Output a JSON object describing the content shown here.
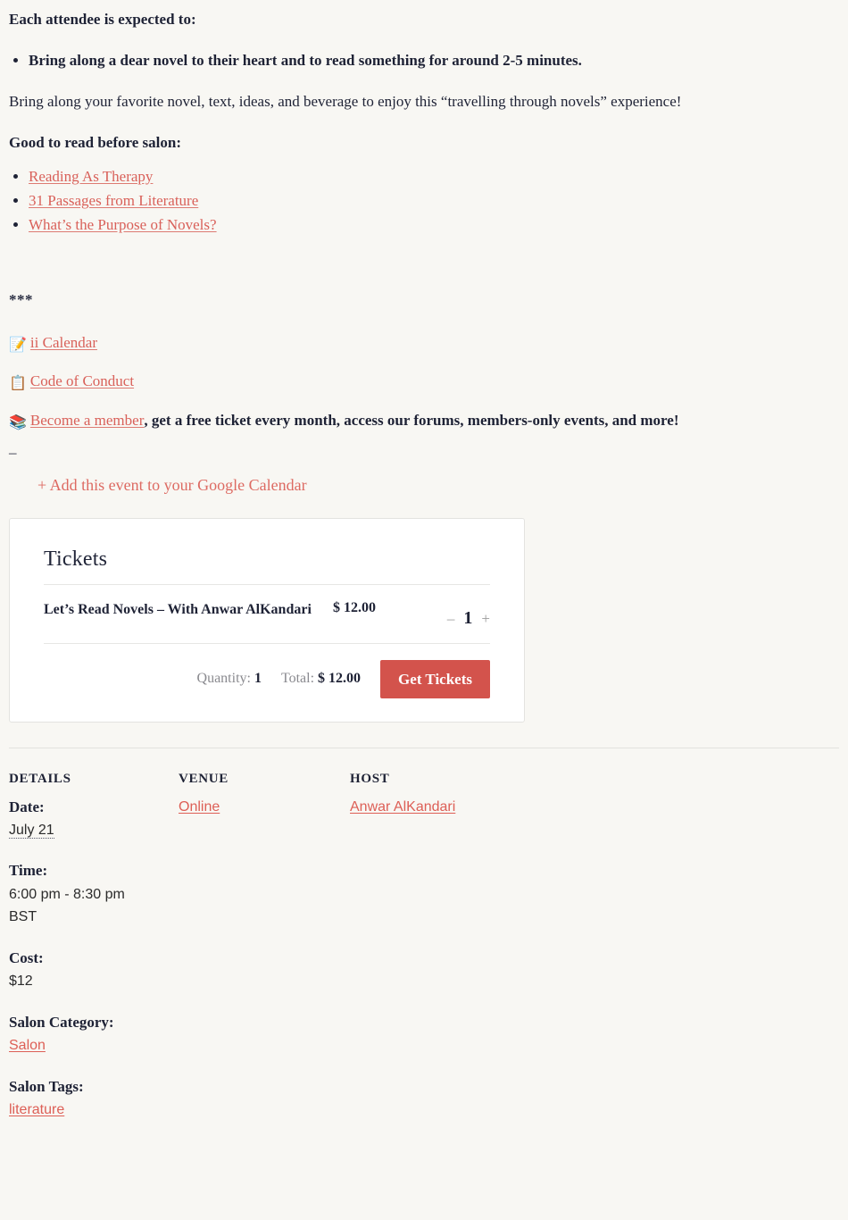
{
  "body": {
    "expect_heading": "Each attendee is expected to:",
    "expect_items": [
      "Bring along a dear novel to their heart and to read something for around 2-5 minutes."
    ],
    "bring_paragraph": "Bring along your favorite novel, text, ideas, and beverage to enjoy this “travelling through novels” experience!",
    "read_heading": "Good to read before salon:",
    "read_links": [
      "Reading As Therapy ",
      "31 Passages from Literature ",
      "What’s the Purpose of Novels?"
    ],
    "separator": "***",
    "resource_rows": [
      {
        "icon": "memo-icon",
        "glyph": "📝",
        "link": "ii Calendar",
        "tail": ""
      },
      {
        "icon": "clipboard-icon",
        "glyph": "📋",
        "link": "Code of Conduct",
        "tail": ""
      },
      {
        "icon": "books-icon",
        "glyph": "📚",
        "link": "Become a member",
        "tail": ", get a free ticket every month, access our forums, members-only events, and more!"
      }
    ],
    "dash": "–",
    "gcal_link": "+ Add this event to your Google Calendar"
  },
  "tickets": {
    "title": "Tickets",
    "row": {
      "name": "Let’s Read Novels – With Anwar AlKandari",
      "price": "$ 12.00",
      "minus": "–",
      "quantity": "1",
      "plus": "+"
    },
    "quantity_label": "Quantity:",
    "quantity_value": "1",
    "total_label": "Total:",
    "total_value": "$ 12.00",
    "button_label": "Get Tickets",
    "accent_color": "#d3534c"
  },
  "details": {
    "heading": "DETAILS",
    "date_label": "Date:",
    "date_value": "July 21",
    "time_label": "Time:",
    "time_value": "6:00 pm - 8:30 pm",
    "timezone": "BST",
    "cost_label": "Cost:",
    "cost_value": "$12",
    "category_label": "Salon Category:",
    "category_value": "Salon",
    "tags_label": "Salon Tags:",
    "tags_value": "literature"
  },
  "venue": {
    "heading": "VENUE",
    "value": "Online"
  },
  "host": {
    "heading": "HOST",
    "value": "Anwar AlKandari"
  },
  "theme": {
    "background": "#f8f7f3",
    "text": "#1e2235",
    "link": "#d9615a"
  }
}
